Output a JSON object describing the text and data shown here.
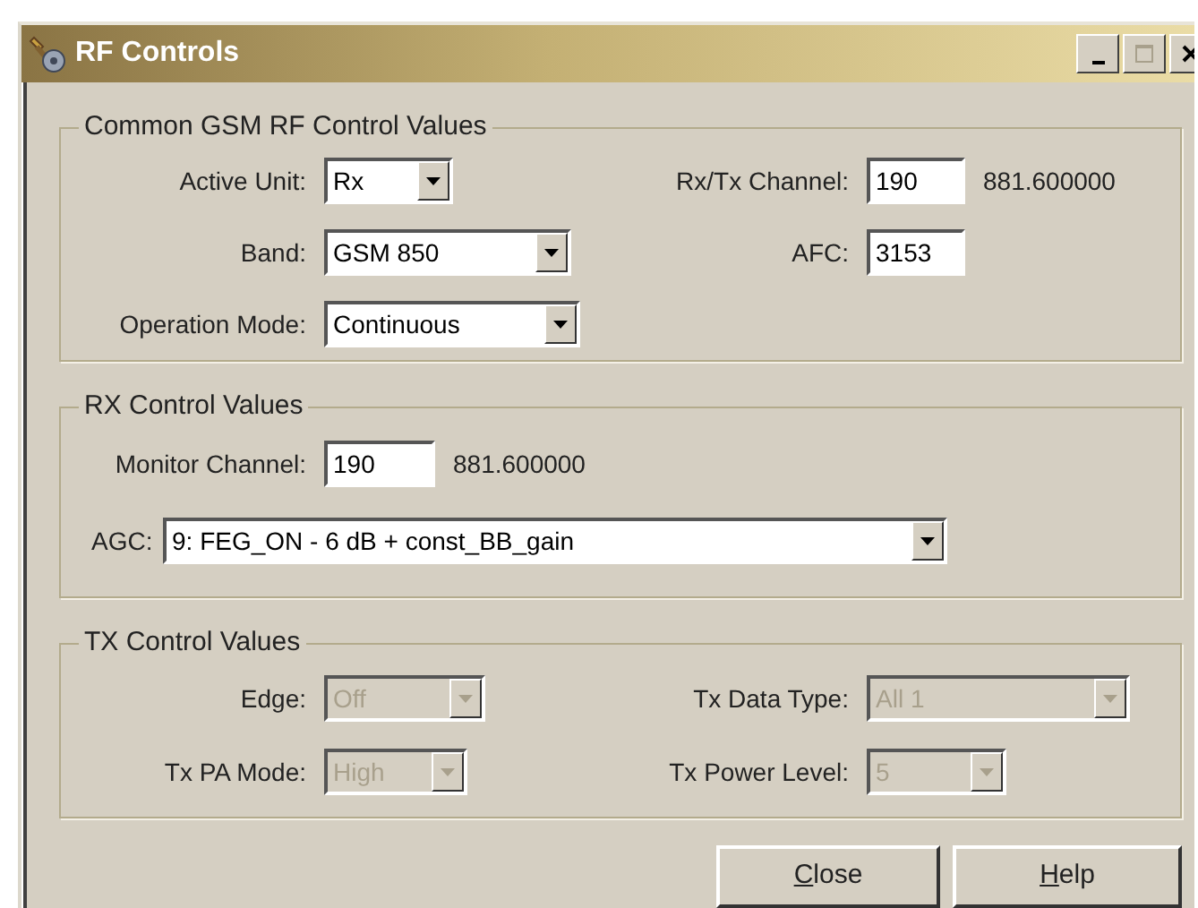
{
  "window": {
    "title": "RF Controls"
  },
  "title_buttons": [
    {
      "kind": "minimize",
      "disabled": false
    },
    {
      "kind": "maximize",
      "disabled": true
    },
    {
      "kind": "close",
      "disabled": false
    }
  ],
  "groups": [
    {
      "title": "Common GSM RF Control Values",
      "rows": [
        [
          {
            "label": "Active Unit:",
            "kind": "combo",
            "value": "Rx",
            "disabled": false
          },
          {
            "label": "Rx/Tx Channel:",
            "kind": "text",
            "value": "190",
            "note": "881.600000"
          }
        ],
        [
          {
            "label": "Band:",
            "kind": "combo",
            "value": "GSM 850",
            "disabled": false
          },
          {
            "label": "AFC:",
            "kind": "text",
            "value": "3153"
          }
        ],
        [
          {
            "label": "Operation Mode:",
            "kind": "combo",
            "value": "Continuous",
            "disabled": false
          }
        ]
      ]
    },
    {
      "title": "RX Control Values",
      "rows": [
        [
          {
            "label": "Monitor Channel:",
            "kind": "text",
            "value": "190",
            "note": "881.600000"
          }
        ],
        [
          {
            "label": "AGC:",
            "kind": "combo",
            "value": "9: FEG_ON - 6 dB + const_BB_gain",
            "disabled": false
          }
        ]
      ]
    },
    {
      "title": "TX Control Values",
      "rows": [
        [
          {
            "label": "Edge:",
            "kind": "combo",
            "value": "Off",
            "disabled": true
          },
          {
            "label": "Tx Data Type:",
            "kind": "combo",
            "value": "All 1",
            "disabled": true
          }
        ],
        [
          {
            "label": "Tx PA Mode:",
            "kind": "combo",
            "value": "High",
            "disabled": true
          },
          {
            "label": "Tx Power Level:",
            "kind": "combo",
            "value": "5",
            "disabled": true
          }
        ]
      ]
    }
  ],
  "buttons": [
    {
      "access_key": "C",
      "rest": "lose"
    },
    {
      "access_key": "H",
      "rest": "elp"
    }
  ]
}
